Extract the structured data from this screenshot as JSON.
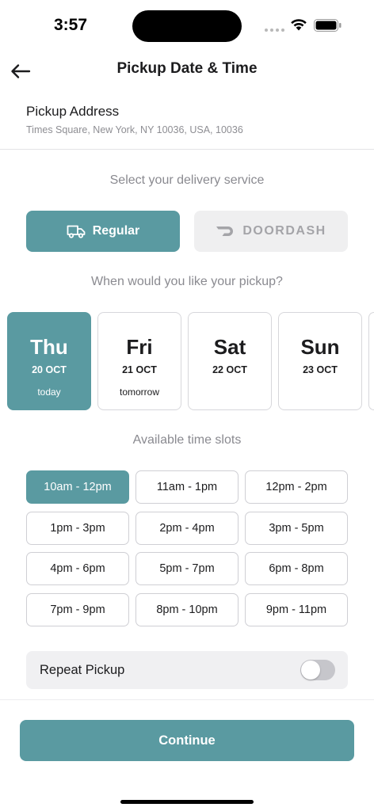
{
  "status": {
    "time": "3:57"
  },
  "header": {
    "title": "Pickup Date & Time"
  },
  "address": {
    "label": "Pickup Address",
    "value": "Times Square, New York, NY 10036, USA, 10036"
  },
  "service": {
    "prompt": "Select your delivery service",
    "options": [
      {
        "label": "Regular",
        "icon": "truck-icon",
        "selected": true
      },
      {
        "label": "DOORDASH",
        "icon": "doordash-logo",
        "selected": false
      }
    ]
  },
  "date": {
    "prompt": "When would you like your pickup?",
    "days": [
      {
        "name": "Thu",
        "date": "20 OCT",
        "sub": "today",
        "selected": true
      },
      {
        "name": "Fri",
        "date": "21 OCT",
        "sub": "tomorrow",
        "selected": false
      },
      {
        "name": "Sat",
        "date": "22 OCT",
        "sub": "",
        "selected": false
      },
      {
        "name": "Sun",
        "date": "23 OCT",
        "sub": "",
        "selected": false
      }
    ]
  },
  "slots": {
    "prompt": "Available time slots",
    "items": [
      "10am - 12pm",
      "11am - 1pm",
      "12pm - 2pm",
      "1pm - 3pm",
      "2pm - 4pm",
      "3pm - 5pm",
      "4pm - 6pm",
      "5pm - 7pm",
      "6pm - 8pm",
      "7pm - 9pm",
      "8pm - 10pm",
      "9pm - 11pm"
    ],
    "selected": "10am - 12pm"
  },
  "repeat": {
    "label": "Repeat Pickup",
    "enabled": false
  },
  "footer": {
    "continue_label": "Continue"
  },
  "colors": {
    "accent": "#5a9aa1",
    "muted_bg": "#efeff0",
    "text": "#1c1c1e",
    "secondary_text": "#8e8e93"
  }
}
